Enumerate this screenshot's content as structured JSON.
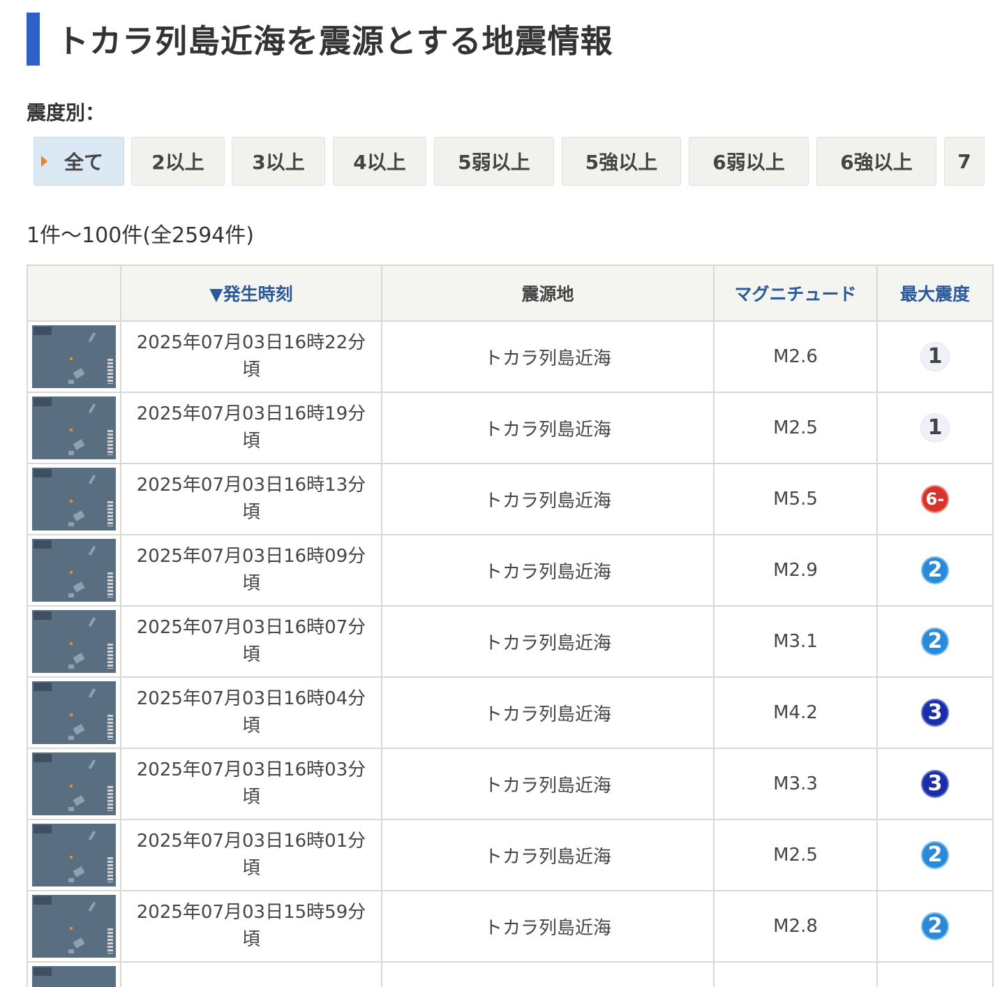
{
  "page": {
    "title": "トカラ列島近海を震源とする地震情報",
    "filter_label": "震度別：",
    "filters": [
      {
        "label": "全て",
        "active": true
      },
      {
        "label": "2以上",
        "active": false
      },
      {
        "label": "3以上",
        "active": false
      },
      {
        "label": "4以上",
        "active": false
      },
      {
        "label": "5弱以上",
        "active": false
      },
      {
        "label": "5強以上",
        "active": false
      },
      {
        "label": "6弱以上",
        "active": false
      },
      {
        "label": "6強以上",
        "active": false
      },
      {
        "label": "7",
        "active": false
      }
    ],
    "count_text": "1件〜100件(全2594件)"
  },
  "table": {
    "headers": {
      "thumb": "",
      "time": "▼発生時刻",
      "epicenter": "震源地",
      "magnitude": "マグニチュード",
      "intensity": "最大震度"
    },
    "rows": [
      {
        "time_line1": "2025年07月03日16時22分",
        "time_line2": "頃",
        "epicenter": "トカラ列島近海",
        "magnitude": "M2.6",
        "intensity": "1",
        "intensity_class": "s1"
      },
      {
        "time_line1": "2025年07月03日16時19分",
        "time_line2": "頃",
        "epicenter": "トカラ列島近海",
        "magnitude": "M2.5",
        "intensity": "1",
        "intensity_class": "s1"
      },
      {
        "time_line1": "2025年07月03日16時13分",
        "time_line2": "頃",
        "epicenter": "トカラ列島近海",
        "magnitude": "M5.5",
        "intensity": "6-",
        "intensity_class": "s6m"
      },
      {
        "time_line1": "2025年07月03日16時09分",
        "time_line2": "頃",
        "epicenter": "トカラ列島近海",
        "magnitude": "M2.9",
        "intensity": "2",
        "intensity_class": "s2"
      },
      {
        "time_line1": "2025年07月03日16時07分",
        "time_line2": "頃",
        "epicenter": "トカラ列島近海",
        "magnitude": "M3.1",
        "intensity": "2",
        "intensity_class": "s2"
      },
      {
        "time_line1": "2025年07月03日16時04分",
        "time_line2": "頃",
        "epicenter": "トカラ列島近海",
        "magnitude": "M4.2",
        "intensity": "3",
        "intensity_class": "s3"
      },
      {
        "time_line1": "2025年07月03日16時03分",
        "time_line2": "頃",
        "epicenter": "トカラ列島近海",
        "magnitude": "M3.3",
        "intensity": "3",
        "intensity_class": "s3"
      },
      {
        "time_line1": "2025年07月03日16時01分",
        "time_line2": "頃",
        "epicenter": "トカラ列島近海",
        "magnitude": "M2.5",
        "intensity": "2",
        "intensity_class": "s2"
      },
      {
        "time_line1": "2025年07月03日15時59分",
        "time_line2": "頃",
        "epicenter": "トカラ列島近海",
        "magnitude": "M2.8",
        "intensity": "2",
        "intensity_class": "s2"
      }
    ]
  }
}
